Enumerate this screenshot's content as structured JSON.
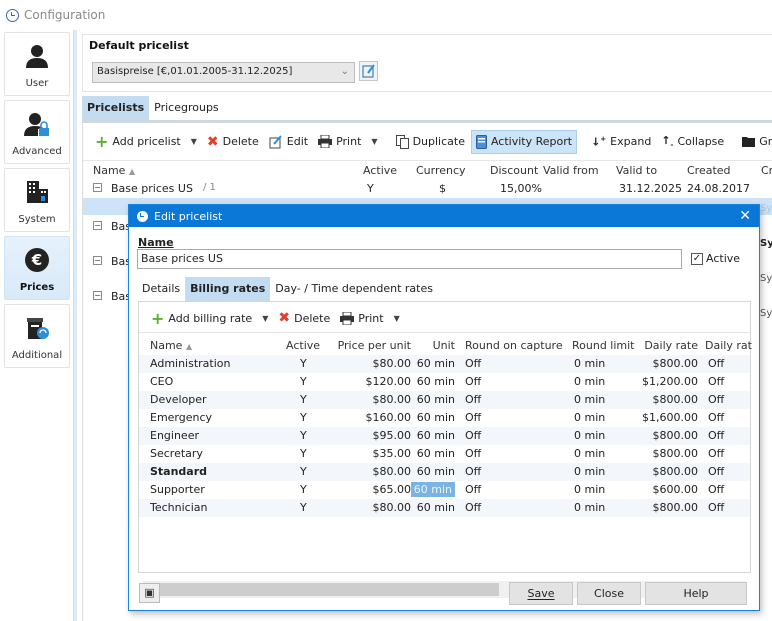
{
  "window": {
    "title": "Configuration"
  },
  "sidebar": {
    "items": [
      {
        "label": "User",
        "icon": "user-icon",
        "active": false
      },
      {
        "label": "Advanced",
        "icon": "user-lock-icon",
        "active": false
      },
      {
        "label": "System",
        "icon": "building-icon",
        "active": false
      },
      {
        "label": "Prices",
        "icon": "euro-icon",
        "active": true
      },
      {
        "label": "Additional",
        "icon": "additional-box-icon",
        "active": false
      }
    ]
  },
  "default_pricelist": {
    "title": "Default pricelist",
    "selected": "Basispreise [€,01.01.2005-31.12.2025]"
  },
  "tabs": [
    {
      "label": "Pricelists",
      "active": true
    },
    {
      "label": "Pricegroups",
      "active": false
    }
  ],
  "toolbar": {
    "add_pricelist": "Add pricelist",
    "delete": "Delete",
    "edit": "Edit",
    "print": "Print",
    "duplicate": "Duplicate",
    "activity_report": "Activity Report",
    "expand": "Expand",
    "collapse": "Collapse",
    "group_by": "Group by"
  },
  "pricelist_grid": {
    "columns": [
      "Name",
      "Active",
      "Currency",
      "Discount",
      "Valid from",
      "Valid to",
      "Created",
      "Cre"
    ],
    "rows": [
      {
        "name": "Base prices US",
        "suffix": "/ 1",
        "active": "Y",
        "currency": "$",
        "discount": "15,00%",
        "valid_from": "",
        "valid_to": "31.12.2025",
        "created": "24.08.2017"
      },
      {
        "name": "Bas"
      },
      {
        "name": "Bas"
      },
      {
        "name": "Bas"
      }
    ],
    "partial_right": [
      "Sy",
      "Sy",
      "Sy",
      "Sy"
    ]
  },
  "dialog": {
    "title": "Edit pricelist",
    "name_label": "Name",
    "name_value": "Base prices US",
    "active_label": "Active",
    "active_checked": true,
    "tabs": [
      {
        "label": "Details",
        "active": false
      },
      {
        "label": "Billing rates",
        "active": true
      },
      {
        "label": "Day- / Time dependent rates",
        "active": false
      }
    ],
    "toolbar": {
      "add_billing_rate": "Add billing rate",
      "delete": "Delete",
      "print": "Print"
    },
    "rates": {
      "columns": [
        "Name",
        "Active",
        "Price per unit",
        "Unit",
        "Round on capture",
        "Round limit",
        "Daily rate",
        "Daily rat"
      ],
      "rows": [
        {
          "name": "Administration",
          "active": "Y",
          "price": "$80.00",
          "unit": "60 min",
          "round": "Off",
          "limit": "0 min",
          "daily": "$800.00",
          "daily2": "Off"
        },
        {
          "name": "CEO",
          "active": "Y",
          "price": "$120.00",
          "unit": "60 min",
          "round": "Off",
          "limit": "0 min",
          "daily": "$1,200.00",
          "daily2": "Off"
        },
        {
          "name": "Developer",
          "active": "Y",
          "price": "$80.00",
          "unit": "60 min",
          "round": "Off",
          "limit": "0 min",
          "daily": "$800.00",
          "daily2": "Off"
        },
        {
          "name": "Emergency",
          "active": "Y",
          "price": "$160.00",
          "unit": "60 min",
          "round": "Off",
          "limit": "0 min",
          "daily": "$1,600.00",
          "daily2": "Off"
        },
        {
          "name": "Engineer",
          "active": "Y",
          "price": "$95.00",
          "unit": "60 min",
          "round": "Off",
          "limit": "0 min",
          "daily": "$800.00",
          "daily2": "Off"
        },
        {
          "name": "Secretary",
          "active": "Y",
          "price": "$35.00",
          "unit": "60 min",
          "round": "Off",
          "limit": "0 min",
          "daily": "$800.00",
          "daily2": "Off"
        },
        {
          "name": "Standard",
          "active": "Y",
          "price": "$80.00",
          "unit": "60 min",
          "round": "Off",
          "limit": "0 min",
          "daily": "$800.00",
          "daily2": "Off",
          "bold": true
        },
        {
          "name": "Supporter",
          "active": "Y",
          "price": "$65.00",
          "unit": "60 min",
          "round": "Off",
          "limit": "0 min",
          "daily": "$600.00",
          "daily2": "Off",
          "unit_selected": true
        },
        {
          "name": "Technician",
          "active": "Y",
          "price": "$80.00",
          "unit": "60 min",
          "round": "Off",
          "limit": "0 min",
          "daily": "$800.00",
          "daily2": "Off"
        }
      ]
    },
    "buttons": {
      "save": "Save",
      "close": "Close",
      "help": "Help"
    }
  }
}
